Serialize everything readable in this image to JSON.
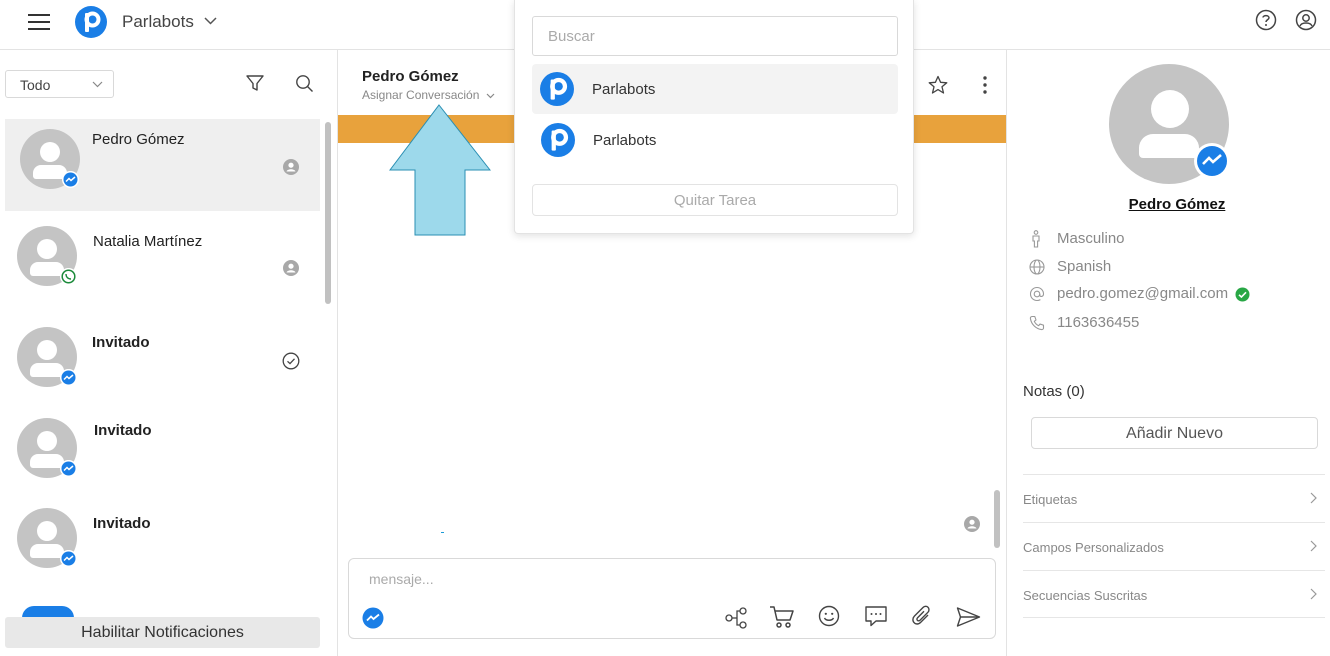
{
  "app": {
    "brand": "Parlabots"
  },
  "colors": {
    "brand_blue": "#1a7ee6",
    "messenger_blue": "#1a7ee6",
    "whatsapp_green": "#25d366",
    "orange_bar": "#e8a23c",
    "arrow_fill": "#9dd9eb",
    "verified_green": "#28a745"
  },
  "left": {
    "filter_label": "Todo",
    "conversations": [
      {
        "name": "Pedro Gómez",
        "channel": "messenger-icon",
        "status": "user-icon",
        "bold": false
      },
      {
        "name": "Natalia Martínez",
        "channel": "whatsapp-icon",
        "status": "user-icon",
        "bold": false
      },
      {
        "name": "Invitado",
        "channel": "messenger-icon",
        "status": "check-circle-icon",
        "bold": true
      },
      {
        "name": "Invitado",
        "channel": "messenger-icon",
        "status": "",
        "bold": true
      },
      {
        "name": "Invitado",
        "channel": "messenger-icon",
        "status": "",
        "bold": true
      }
    ],
    "notifications_button": "Habilitar Notificaciones"
  },
  "center": {
    "contact_name": "Pedro Gómez",
    "assign_label": "Asignar Conversación",
    "message_placeholder": "mensaje..."
  },
  "popup": {
    "search_placeholder": "Buscar",
    "items": [
      {
        "label": "Parlabots"
      },
      {
        "label": "Parlabots"
      }
    ],
    "remove_label": "Quitar Tarea"
  },
  "right": {
    "name": "Pedro Gómez",
    "gender": "Masculino",
    "language": "Spanish",
    "email": "pedro.gomez@gmail.com",
    "phone": "1163636455",
    "notes_label": "Notas (0)",
    "add_button": "Añadir Nuevo",
    "sections": [
      {
        "label": "Etiquetas"
      },
      {
        "label": "Campos Personalizados"
      },
      {
        "label": "Secuencias Suscritas"
      }
    ]
  }
}
